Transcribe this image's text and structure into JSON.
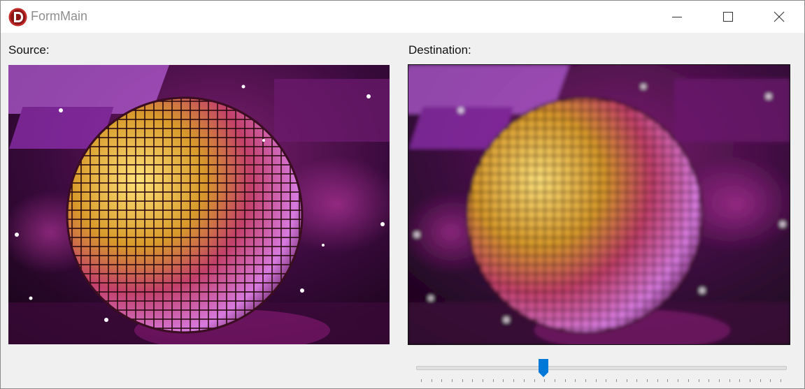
{
  "window": {
    "title": "FormMain",
    "app_icon": "delphi-d-icon",
    "controls": [
      "minimize-icon",
      "maximize-icon",
      "close-icon"
    ]
  },
  "source": {
    "label": "Source:",
    "image_description_icon": "disco-ball-image"
  },
  "destination": {
    "label": "Destination:",
    "image_description_icon": "blurred-disco-ball-image"
  },
  "slider": {
    "position_fraction": 0.34,
    "tick_count": 36,
    "accent_color": "#0078d7"
  },
  "colors": {
    "accent": "#0078d7",
    "icon_red": "#c22a2a"
  }
}
